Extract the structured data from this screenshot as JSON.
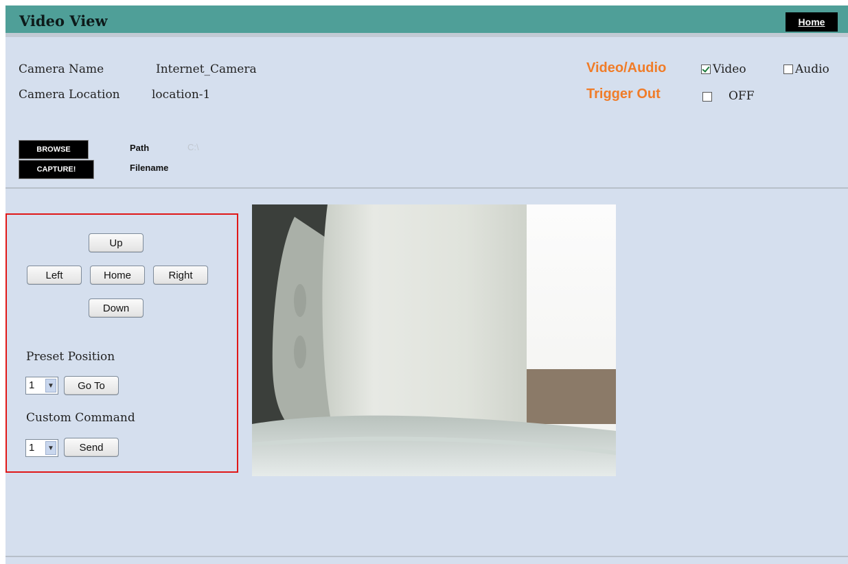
{
  "header": {
    "title": "Video View",
    "home_link": "Home"
  },
  "camera_info": {
    "name_label": "Camera Name",
    "name_value": "Internet_Camera",
    "location_label": "Camera Location",
    "location_value": "location-1"
  },
  "options": {
    "video_audio_label": "Video/Audio",
    "video_label": "Video",
    "video_checked": true,
    "audio_label": "Audio",
    "audio_checked": false,
    "trigger_out_label": "Trigger Out",
    "trigger_out_state": "OFF",
    "trigger_checked": false
  },
  "capture": {
    "browse_label": "BROWSE",
    "capture_label": "CAPTURE!",
    "path_label": "Path",
    "path_value": "C:\\",
    "filename_label": "Filename"
  },
  "controls": {
    "up": "Up",
    "left": "Left",
    "home": "Home",
    "right": "Right",
    "down": "Down",
    "preset_label": "Preset Position",
    "preset_value": "1",
    "goto_label": "Go To",
    "custom_label": "Custom Command",
    "custom_value": "1",
    "send_label": "Send"
  },
  "colors": {
    "header_bg": "#4f9f98",
    "accent_orange": "#f07c28",
    "page_bg": "#d5dfee",
    "highlight_border": "#e01616"
  },
  "icons": {
    "dropdown": "chevron-down-icon",
    "check": "checkmark-icon"
  }
}
